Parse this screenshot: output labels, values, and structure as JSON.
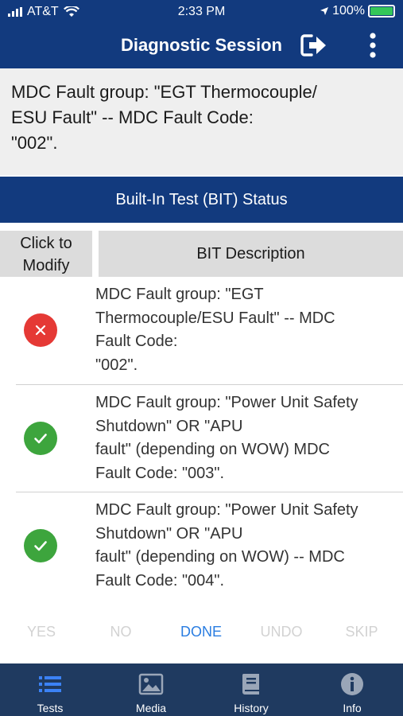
{
  "status_bar": {
    "carrier": "AT&T",
    "time": "2:33 PM",
    "battery": "100%",
    "battery_level": 1.0
  },
  "header": {
    "title": "Diagnostic Session",
    "exit_icon": "exit-icon",
    "more_icon": "more-vertical-icon"
  },
  "fault_banner": {
    "text": "MDC Fault group:  \"EGT Thermocouple/\nESU Fault\" -- MDC Fault Code:\n \"002\"."
  },
  "bit_section": {
    "title": "Built-In Test (BIT) Status",
    "col_modify": "Click to\nModify",
    "col_description": "BIT Description"
  },
  "rows": [
    {
      "status": "fail",
      "icon": "x-icon",
      "description": "MDC Fault group:  \"EGT\nThermocouple/ESU Fault\" -- MDC\nFault Code:\n \"002\"."
    },
    {
      "status": "pass",
      "icon": "check-icon",
      "description": "MDC Fault group: \"Power Unit Safety\nShutdown\" OR \"APU\nfault\" (depending on WOW) MDC\nFault Code: \"003\"."
    },
    {
      "status": "pass",
      "icon": "check-icon",
      "description": "MDC Fault group:  \"Power Unit Safety\nShutdown\" OR \"APU\nfault\" (depending on WOW) -- MDC\nFault Code:  \"004\"."
    }
  ],
  "actions": {
    "yes": "YES",
    "no": "NO",
    "done": "DONE",
    "undo": "UNDO",
    "skip": "SKIP"
  },
  "tabs": [
    {
      "label": "Tests",
      "icon": "list-icon",
      "active": true
    },
    {
      "label": "Media",
      "icon": "image-icon",
      "active": false
    },
    {
      "label": "History",
      "icon": "book-icon",
      "active": false
    },
    {
      "label": "Info",
      "icon": "info-icon",
      "active": false
    }
  ],
  "colors": {
    "header_bg": "#123a7e",
    "tabbar_bg": "#1f3a60",
    "fail": "#e53935",
    "pass": "#3da53d",
    "active_action": "#2a7de1",
    "disabled_action": "#d2d2d2",
    "active_tab_icon": "#3b82f6"
  }
}
